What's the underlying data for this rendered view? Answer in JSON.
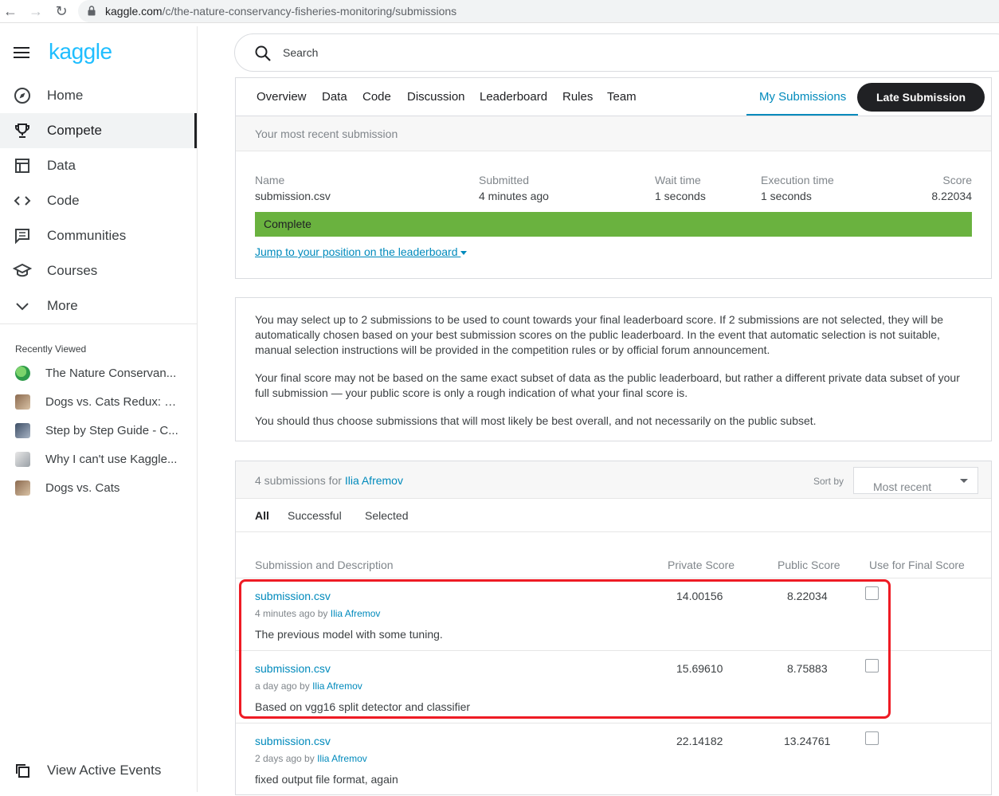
{
  "browser": {
    "url_domain": "kaggle.com",
    "url_path": "/c/the-nature-conservancy-fisheries-monitoring/submissions"
  },
  "sidebar": {
    "logo": "kaggle",
    "items": [
      {
        "label": "Home",
        "icon": "compass-icon"
      },
      {
        "label": "Compete",
        "icon": "trophy-icon"
      },
      {
        "label": "Data",
        "icon": "table-icon"
      },
      {
        "label": "Code",
        "icon": "code-icon"
      },
      {
        "label": "Communities",
        "icon": "comment-icon"
      },
      {
        "label": "Courses",
        "icon": "school-icon"
      },
      {
        "label": "More",
        "icon": "chevron-down-icon"
      }
    ],
    "recent_heading": "Recently Viewed",
    "recent": [
      {
        "label": "The Nature Conservan..."
      },
      {
        "label": "Dogs vs. Cats Redux: K..."
      },
      {
        "label": "Step by Step Guide - C..."
      },
      {
        "label": "Why I can't use Kaggle..."
      },
      {
        "label": "Dogs vs. Cats"
      }
    ],
    "view_events": "View Active Events"
  },
  "search": {
    "placeholder": "Search"
  },
  "tabs": {
    "overview": "Overview",
    "data": "Data",
    "code": "Code",
    "discussion": "Discussion",
    "leaderboard": "Leaderboard",
    "rules": "Rules",
    "team": "Team",
    "my_submissions": "My Submissions",
    "late_submission": "Late Submission"
  },
  "recent_submission": {
    "heading": "Your most recent submission",
    "name_label": "Name",
    "name_value": "submission.csv",
    "submitted_label": "Submitted",
    "submitted_value": "4 minutes ago",
    "wait_label": "Wait time",
    "wait_value": "1 seconds",
    "exec_label": "Execution time",
    "exec_value": "1 seconds",
    "score_label": "Score",
    "score_value": "8.22034",
    "status": "Complete",
    "jump_link": "Jump to your position on the leaderboard"
  },
  "info": {
    "p1": "You may select up to 2 submissions to be used to count towards your final leaderboard score. If 2 submissions are not selected, they will be automatically chosen based on your best submission scores on the public leaderboard. In the event that automatic selection is not suitable, manual selection instructions will be provided in the competition rules or by official forum announcement.",
    "p2": "Your final score may not be based on the same exact subset of data as the public leaderboard, but rather a different private data subset of your full submission — your public score is only a rough indication of what your final score is.",
    "p3": "You should thus choose submissions that will most likely be best overall, and not necessarily on the public subset."
  },
  "submissions": {
    "count_text": "4 submissions for",
    "user": "Ilia Afremov",
    "sort_label": "Sort by",
    "sort_value": "Most recent",
    "filters": {
      "all": "All",
      "successful": "Successful",
      "selected": "Selected"
    },
    "headers": {
      "desc": "Submission and Description",
      "private": "Private Score",
      "public": "Public Score",
      "final": "Use for Final Score"
    },
    "rows": [
      {
        "name": "submission.csv",
        "when": "4 minutes ago by",
        "by": "Ilia Afremov",
        "desc": "The previous model with some tuning.",
        "private": "14.00156",
        "public": "8.22034"
      },
      {
        "name": "submission.csv",
        "when": "a day ago by",
        "by": "Ilia Afremov",
        "desc": "Based on vgg16 split detector and classifier",
        "private": "15.69610",
        "public": "8.75883"
      },
      {
        "name": "submission.csv",
        "when": "2 days ago by",
        "by": "Ilia Afremov",
        "desc": "fixed output file format, again",
        "private": "22.14182",
        "public": "13.24761"
      }
    ]
  }
}
